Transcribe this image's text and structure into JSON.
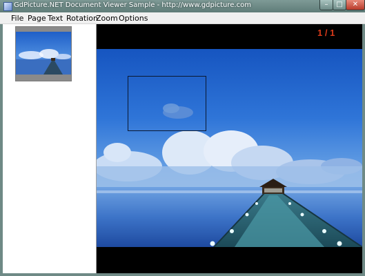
{
  "window": {
    "title": "GdPicture.NET Document Viewer Sample - http://www.gdpicture.com",
    "controls": {
      "minimize": "–",
      "maximize": "□",
      "close": "✕"
    }
  },
  "menu": {
    "items": [
      {
        "label": "File"
      },
      {
        "label": "Page"
      },
      {
        "label": "Text"
      },
      {
        "label": "Rotation"
      },
      {
        "label": "Zoom"
      },
      {
        "label": "Options"
      }
    ]
  },
  "viewer": {
    "page_indicator": "1 / 1"
  },
  "colors": {
    "page_indicator": "#d83a1a",
    "viewer_background": "#000000",
    "sidebar_background": "#ffffff"
  }
}
